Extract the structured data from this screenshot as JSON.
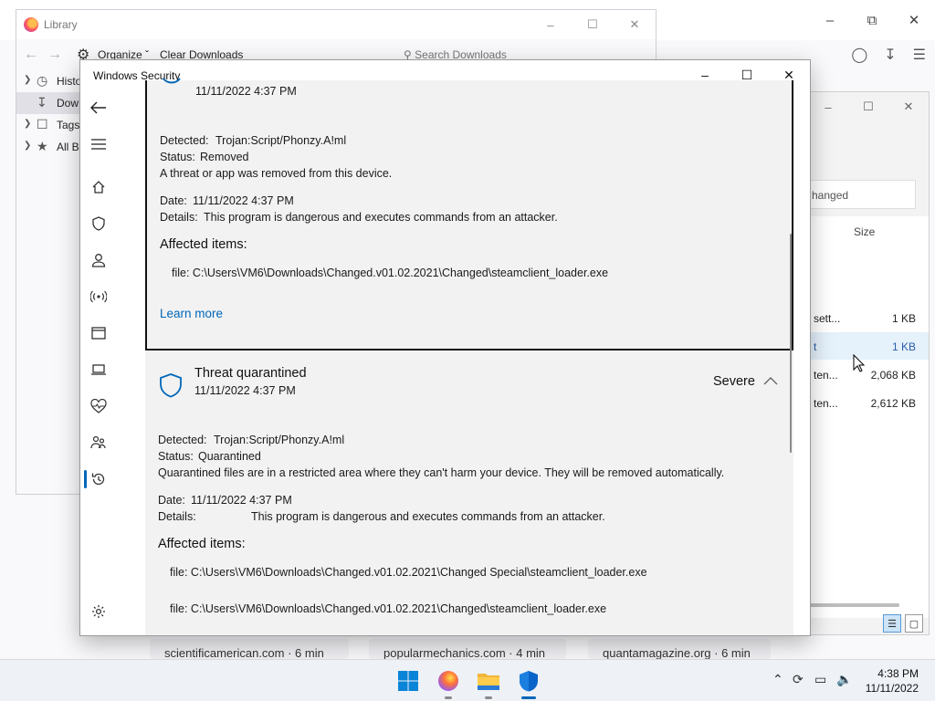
{
  "browser": {
    "tiles": [
      "scientificamerican.com · 6 min",
      "popularmechanics.com · 4 min",
      "quantamagazine.org · 6 min"
    ]
  },
  "explorer": {
    "search_text": "hanged",
    "size_header": "Size",
    "rows": [
      {
        "name": "sett...",
        "size": "1 KB"
      },
      {
        "name": "t",
        "size": "1 KB"
      },
      {
        "name": "ten...",
        "size": "2,068 KB"
      },
      {
        "name": "ten...",
        "size": "2,612 KB"
      }
    ]
  },
  "library": {
    "title": "Library",
    "organize": "Organize",
    "clear_downloads": "Clear Downloads",
    "search_placeholder": "Search Downloads",
    "tree": [
      {
        "label": "Histo",
        "icon": "clock-icon"
      },
      {
        "label": "Dow",
        "icon": "download-icon"
      },
      {
        "label": "Tags",
        "icon": "tag-icon"
      },
      {
        "label": "All B",
        "icon": "star-icon"
      }
    ]
  },
  "security": {
    "title": "Windows Security",
    "card1": {
      "time_partial": "11/11/2022 4:37 PM",
      "detected_label": "Detected:",
      "detected_value": "Trojan:Script/Phonzy.A!ml",
      "status_label": "Status:",
      "status_value": "Removed",
      "message": "A threat or app was removed from this device.",
      "date_label": "Date:",
      "date_value": "11/11/2022 4:37 PM",
      "details_label": "Details:",
      "details_value": "This program is dangerous and executes commands from an attacker.",
      "affected_heading": "Affected items:",
      "file1": "file: C:\\Users\\VM6\\Downloads\\Changed.v01.02.2021\\Changed\\steamclient_loader.exe",
      "learn_more": "Learn more"
    },
    "card2": {
      "title": "Threat quarantined",
      "time": "11/11/2022 4:37 PM",
      "severity": "Severe",
      "detected_label": "Detected:",
      "detected_value": "Trojan:Script/Phonzy.A!ml",
      "status_label": "Status:",
      "status_value": "Quarantined",
      "message": "Quarantined files are in a restricted area where they can't harm your device. They will be removed automatically.",
      "date_label": "Date:",
      "date_value": "11/11/2022 4:37 PM",
      "details_label": "Details:",
      "details_value": "This program is dangerous and executes commands from an attacker.",
      "affected_heading": "Affected items:",
      "file1": "file: C:\\Users\\VM6\\Downloads\\Changed.v01.02.2021\\Changed Special\\steamclient_loader.exe",
      "file2": "file: C:\\Users\\VM6\\Downloads\\Changed.v01.02.2021\\Changed\\steamclient_loader.exe"
    }
  },
  "taskbar": {
    "time": "4:38 PM",
    "date": "11/11/2022"
  },
  "colors": {
    "accent": "#0067b8",
    "card_bg": "#f2f2f2",
    "taskbar_bg": "#eef1f6"
  }
}
